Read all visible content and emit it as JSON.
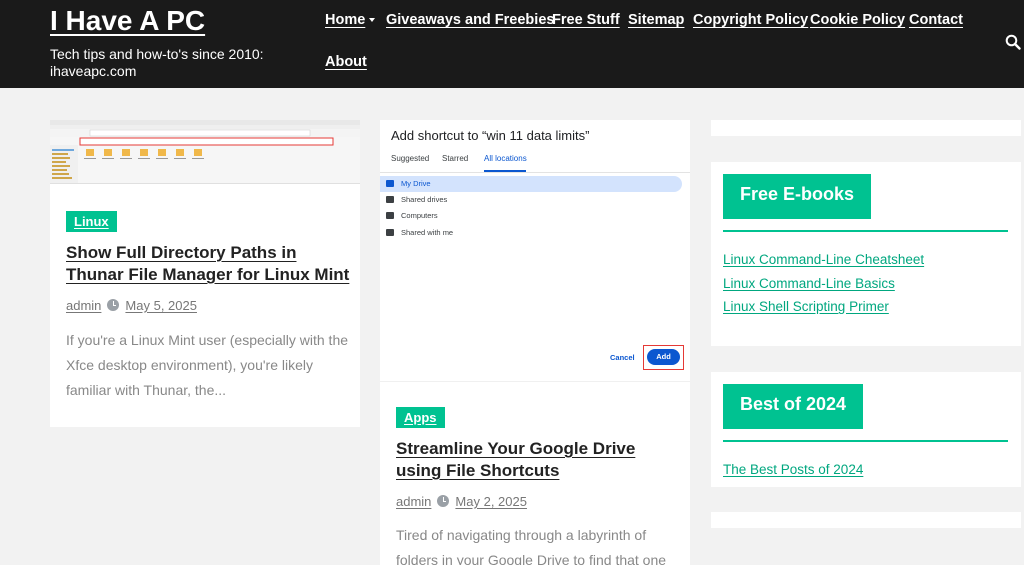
{
  "site": {
    "title": "I Have A PC",
    "tagline": "Tech tips and how-to's since 2010: ihaveapc.com"
  },
  "nav": {
    "items": [
      {
        "label": "Home",
        "active": true,
        "has_dropdown": true
      },
      {
        "label": "Giveaways and Freebies"
      },
      {
        "label": "Free Stuff"
      },
      {
        "label": "Sitemap"
      },
      {
        "label": "Copyright Policy"
      },
      {
        "label": "Cookie Policy"
      },
      {
        "label": "Contact"
      },
      {
        "label": "About"
      }
    ],
    "search_icon": "search-icon"
  },
  "posts": [
    {
      "category": "Linux",
      "title": "Show Full Directory Paths in Thunar File Manager for Linux Mint",
      "author": "admin",
      "date": "May 5, 2025",
      "excerpt": "If you're a Linux Mint user (especially with the Xfce desktop environment), you're likely familiar with Thunar, the..."
    },
    {
      "category": "Apps",
      "title": "Streamline Your Google Drive using File Shortcuts",
      "author": "admin",
      "date": "May 2, 2025",
      "excerpt": "Tired of navigating through a labyrinth of folders in your Google Drive to find that one",
      "thumbnail": {
        "dialog_title": "Add shortcut to “win 11 data limits”",
        "tabs": [
          "Suggested",
          "Starred",
          "All locations"
        ],
        "selected_tab": "All locations",
        "locations": [
          "My Drive",
          "Shared drives",
          "Computers",
          "Shared with me"
        ],
        "selected_location": "My Drive",
        "cancel_label": "Cancel",
        "add_label": "Add"
      }
    }
  ],
  "sidebar": {
    "ebooks": {
      "title": "Free E-books",
      "links": [
        "Linux Command-Line Cheatsheet",
        "Linux Command-Line Basics",
        "Linux Shell Scripting Primer"
      ]
    },
    "best": {
      "title": "Best of 2024",
      "links": [
        "The Best Posts of 2024"
      ]
    }
  },
  "colors": {
    "accent": "#00c291",
    "header_bg": "#1a1a1a",
    "page_bg": "#f2f2f2",
    "link": "#00a77f"
  }
}
